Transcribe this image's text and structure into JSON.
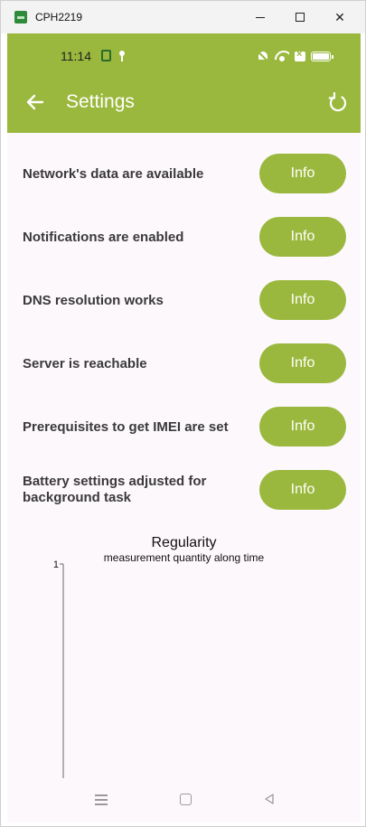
{
  "window": {
    "title": "CPH2219",
    "minimize_glyph": "",
    "close_glyph": "✕"
  },
  "status_bar": {
    "time": "11:14"
  },
  "appbar": {
    "title": "Settings",
    "back_icon": "arrow-left-icon",
    "refresh_icon": "refresh-icon",
    "background": "#9ab83d"
  },
  "checks": [
    {
      "label": "Network's data are available",
      "button": "Info"
    },
    {
      "label": "Notifications are enabled",
      "button": "Info"
    },
    {
      "label": "DNS resolution works",
      "button": "Info"
    },
    {
      "label": "Server is reachable",
      "button": "Info"
    },
    {
      "label": "Prerequisites to get IMEI are set",
      "button": "Info"
    },
    {
      "label": "Battery settings adjusted for background task",
      "button": "Info"
    }
  ],
  "chart_data": {
    "type": "line",
    "title": "Regularity",
    "subtitle": "measurement quantity along time",
    "y_ticks": [
      "1"
    ],
    "ylim": [
      0,
      1
    ],
    "series": []
  },
  "accent_color": "#9ab83d"
}
